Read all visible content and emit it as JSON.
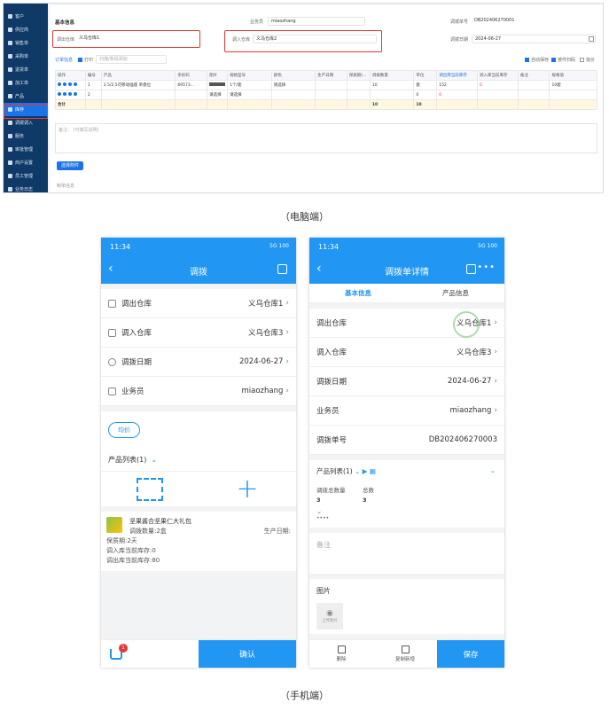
{
  "desktop": {
    "sidebar": [
      "客户",
      "供应商",
      "销售单",
      "采购单",
      "退货单",
      "加工单",
      "产品",
      "库存",
      "调拨调入",
      "服务",
      "审批管理",
      "商户设置",
      "员工管理",
      "业务日志"
    ],
    "section_title": "基本信息",
    "fields": {
      "salesman_label": "业务员",
      "salesman_value": "miaozhang",
      "doc_no_label": "调拨单号",
      "doc_no_value": "DB202406270001",
      "out_wh_label": "调出仓库",
      "out_wh_value": "义乌仓库1",
      "in_wh_label": "调入仓库",
      "in_wh_value": "义乌仓库2",
      "date_label": "调拨日期",
      "date_value": "2024-06-27"
    },
    "product_info_label": "订单信息",
    "print_label": "打印",
    "scan_placeholder": "扫描/条码添加",
    "options": [
      "自动保存",
      "按件扫码",
      "批价"
    ],
    "table": {
      "headers": [
        "操作",
        "编号",
        "产品",
        "条形码",
        "图片",
        "规格型号",
        "颜色",
        "生产日期",
        "保质期(...",
        "调拨数量",
        "单位",
        "调出库当前库存",
        "调入库当前库存",
        "备注",
        "规格值"
      ],
      "rows": [
        [
          "1",
          "2.5/2.5可移动插座 单盘位",
          "69573...",
          "1个/套",
          "请选择",
          "",
          "",
          "10",
          "套",
          "152",
          "0",
          "",
          "10套"
        ],
        [
          "2",
          "",
          "",
          "请选择",
          "请选择",
          "",
          "",
          "",
          "",
          "0",
          "0",
          "",
          ""
        ]
      ],
      "sum_label": "合计",
      "sum_qty": "10",
      "sum_qty2": "10"
    },
    "remark_placeholder": "备注：  (可填写说明)",
    "attach_button": "选择附件",
    "footer_label": "制单信息"
  },
  "caption_desktop": "（电脑端）",
  "caption_mobile": "（手机端）",
  "phone1": {
    "time": "11:34",
    "status": "5G 100",
    "title": "调拨",
    "rows": [
      {
        "label": "调出仓库",
        "value": "义乌仓库1"
      },
      {
        "label": "调入仓库",
        "value": "义乌仓库3"
      },
      {
        "label": "调拨日期",
        "value": "2024-06-27"
      },
      {
        "label": "业务员",
        "value": "miaozhang"
      }
    ],
    "price_button": "均价",
    "list_title": "产品列表(1)",
    "product": {
      "name": "坚果酱合坚果仁大礼包",
      "qty": "调拨数量:2盒",
      "prod_date": "生产日期:",
      "shelf": "保质期:2天",
      "in_stock": "调入库当前库存:0",
      "out_stock": "调出库当前库存:80"
    },
    "cart_badge": "1",
    "confirm": "确认"
  },
  "phone2": {
    "time": "11:34",
    "status": "5G 100",
    "title": "调拨单详情",
    "tabs": [
      "基本信息",
      "产品信息"
    ],
    "rows": [
      {
        "label": "调出仓库",
        "value": "义乌仓库1"
      },
      {
        "label": "调入仓库",
        "value": "义乌仓库3"
      },
      {
        "label": "调拨日期",
        "value": "2024-06-27"
      },
      {
        "label": "业务员",
        "value": "miaozhang"
      },
      {
        "label": "调拨单号",
        "value": "DB202406270003"
      }
    ],
    "list_title": "产品列表(1)",
    "total_qty_label": "调拨总数量",
    "total_qty": "3",
    "total_label": "总数",
    "total": "3",
    "dots": "••••",
    "remark": "备注",
    "image_label": "图片",
    "upload": "上传图片",
    "actions": [
      "删除",
      "复制新增"
    ],
    "save": "保存"
  }
}
